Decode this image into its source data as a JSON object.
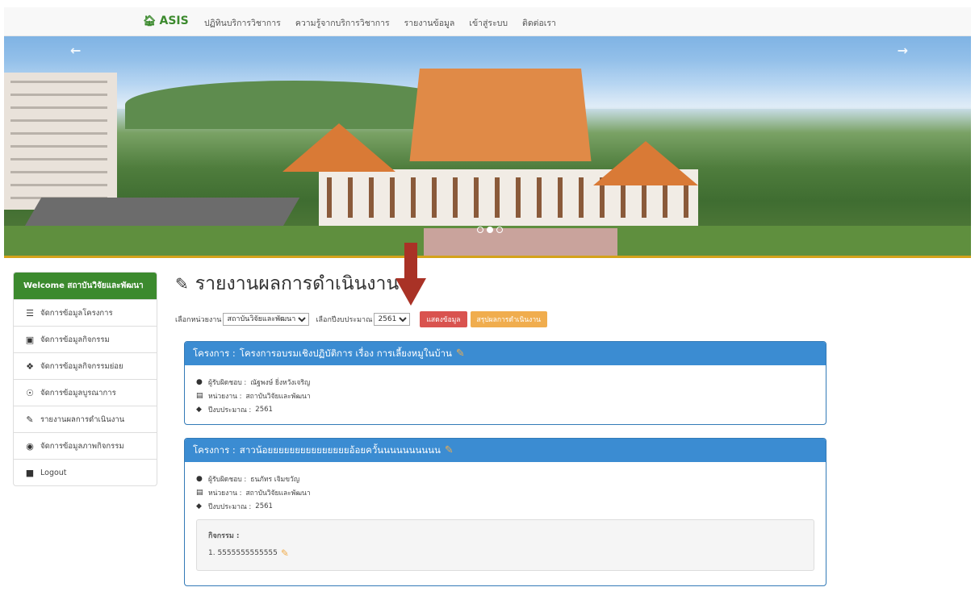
{
  "nav": {
    "brand": "ASIS",
    "links": [
      "ปฏิทินบริการวิชาการ",
      "ความรู้จากบริการวิชาการ",
      "รายงานข้อมูล",
      "เข้าสู่ระบบ",
      "ติดต่อเรา"
    ]
  },
  "banner": {
    "prev_arrow": "←",
    "next_arrow": "→",
    "slides_total": 3,
    "active_slide": 2
  },
  "sidebar": {
    "welcome": "Welcome สถาบันวิจัยและพัฒนา",
    "items": [
      {
        "label": "จัดการข้อมูลโครงการ",
        "icon": "list-icon"
      },
      {
        "label": "จัดการข้อมูลกิจกรรม",
        "icon": "cube-icon"
      },
      {
        "label": "จัดการข้อมูลกิจกรรมย่อย",
        "icon": "cubes-icon"
      },
      {
        "label": "จัดการข้อมูลบูรณาการ",
        "icon": "lifebuoy-icon"
      },
      {
        "label": "รายงานผลการดำเนินงาน",
        "icon": "edit-icon"
      },
      {
        "label": "จัดการข้อมูลภาพกิจกรรม",
        "icon": "camera-icon"
      },
      {
        "label": "Logout",
        "icon": "lock-icon"
      }
    ]
  },
  "page": {
    "title": "รายงานผลการดำเนินงาน"
  },
  "filters": {
    "unit_label": "เลือกหน่วยงาน",
    "unit_value": "สถาบันวิจัยและพัฒนา",
    "year_label": "เลือกปีงบประมาณ",
    "year_value": "2561",
    "show_button": "แสดงข้อมูล",
    "summary_button": "สรุปผลการดำเนินงาน"
  },
  "projects": [
    {
      "prefix": "โครงการ :",
      "name": "โครงการอบรมเชิงปฏิบัติการ เรื่อง การเลี้ยงหมูในบ้าน",
      "owner_label": "ผู้รับผิดชอบ :",
      "owner": "ณัฐพงษ์ ยิ่งหวังเจริญ",
      "unit_label": "หน่วยงาน :",
      "unit": "สถาบันวิจัยและพัฒนา",
      "year_label": "ปีงบประมาณ :",
      "year": "2561"
    },
    {
      "prefix": "โครงการ :",
      "name": "สาวน้อยยยยยยยยยยยยยยยอ้อยควั้นนนนนนนนนน",
      "owner_label": "ผู้รับผิดชอบ :",
      "owner": "ธนภัทร เจิมขวัญ",
      "unit_label": "หน่วยงาน :",
      "unit": "สถาบันวิจัยและพัฒนา",
      "year_label": "ปีงบประมาณ :",
      "year": "2561",
      "activities_label": "กิจกรรม :",
      "activities": [
        "1. 5555555555555"
      ]
    }
  ],
  "colors": {
    "brand_green": "#3c8a2e",
    "panel_blue": "#3b8cd2",
    "button_red": "#d9534f",
    "button_orange": "#f0ad4e",
    "accent_arrow": "#a93226"
  }
}
